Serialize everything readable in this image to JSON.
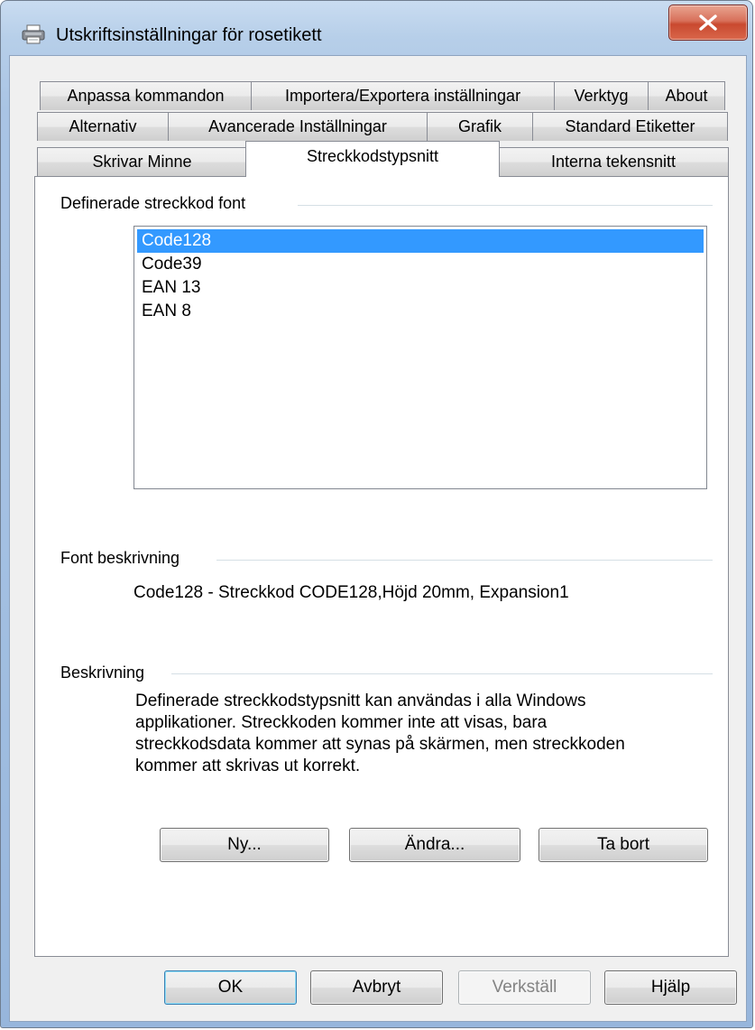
{
  "window": {
    "title": "Utskriftsinställningar för rosetikett",
    "close_glyph": "x"
  },
  "tabs": {
    "row1": [
      "Anpassa kommandon",
      "Importera/Exportera inställningar",
      "Verktyg",
      "About"
    ],
    "row2": [
      "Alternativ",
      "Avancerade Inställningar",
      "Grafik",
      "Standard Etiketter"
    ],
    "row3": [
      "Skrivar Minne",
      "Streckkodstypsnitt",
      "Interna tekensnitt"
    ],
    "active": "Streckkodstypsnitt"
  },
  "defined_fonts": {
    "title": "Definerade streckkod font",
    "items": [
      "Code128",
      "Code39",
      "EAN 13",
      "EAN 8"
    ],
    "selected": "Code128"
  },
  "font_description": {
    "title": "Font beskrivning",
    "text": "Code128 - Streckkod CODE128,Höjd 20mm, Expansion1"
  },
  "description": {
    "title": "Beskrivning",
    "lines": [
      "Definerade streckkodstypsnitt kan användas i alla Windows",
      "applikationer. Streckkoden kommer inte att visas, bara",
      "streckkodsdata kommer att synas på skärmen, men streckkoden",
      "kommer att skrivas ut korrekt."
    ]
  },
  "panel_buttons": {
    "new": "Ny...",
    "edit": "Ändra...",
    "delete": "Ta bort"
  },
  "dialog_buttons": {
    "ok": "OK",
    "cancel": "Avbryt",
    "apply": "Verkställ",
    "help": "Hjälp"
  },
  "icons": {
    "app": "printer-icon",
    "close": "close-icon"
  }
}
